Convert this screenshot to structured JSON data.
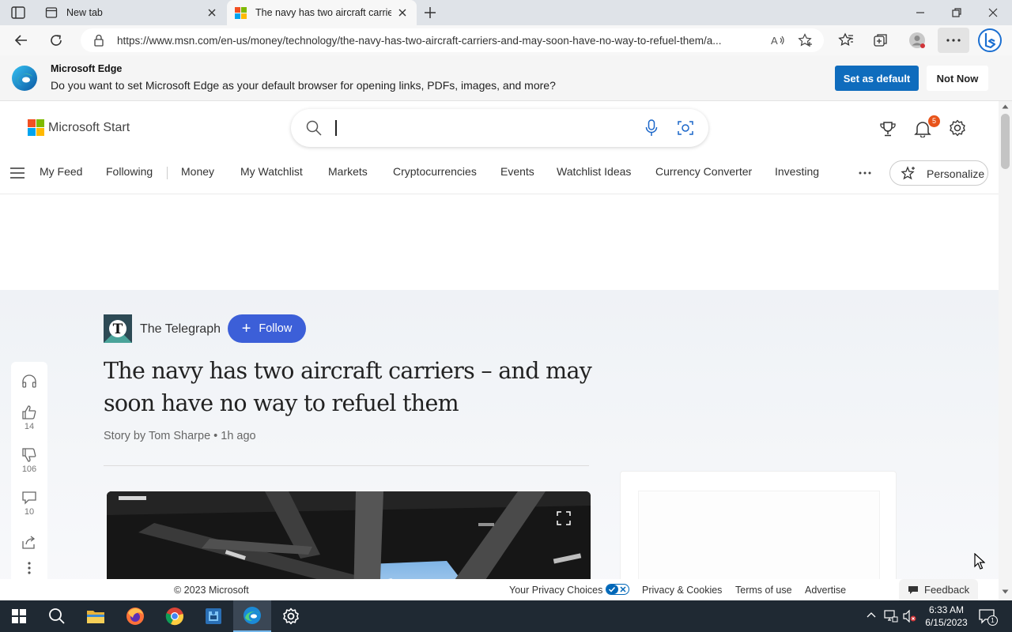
{
  "browser": {
    "tabs": [
      {
        "label": "New tab",
        "active": false
      },
      {
        "label": "The navy has two aircraft carriers – and may soon have no way to refuel them",
        "active": true
      }
    ],
    "url": "https://www.msn.com/en-us/money/technology/the-navy-has-two-aircraft-carriers-and-may-soon-have-no-way-to-refuel-them/a..."
  },
  "infobar": {
    "title": "Microsoft Edge",
    "message": "Do you want to set Microsoft Edge as your default browser for opening links, PDFs, images, and more?",
    "primary_button": "Set as default",
    "secondary_button": "Not Now"
  },
  "site": {
    "brand": "Microsoft Start",
    "notification_count": "5",
    "nav": [
      "My Feed",
      "Following",
      "Money",
      "My Watchlist",
      "Markets",
      "Cryptocurrencies",
      "Events",
      "Watchlist Ideas",
      "Currency Converter",
      "Investing"
    ],
    "personalize": "Personalize"
  },
  "article": {
    "publisher": "The Telegraph",
    "follow_label": "Follow",
    "headline": "The navy has two aircraft carriers – and may soon have no way to refuel them",
    "byline": "Story by Tom Sharpe • 1h ago",
    "likes": "14",
    "dislikes": "106",
    "comments": "10"
  },
  "footer": {
    "copyright": "© 2023 Microsoft",
    "privacy_choices": "Your Privacy Choices",
    "privacy_cookies": "Privacy & Cookies",
    "terms": "Terms of use",
    "advertise": "Advertise",
    "feedback": "Feedback"
  },
  "taskbar": {
    "time": "6:33 AM",
    "date": "6/15/2023",
    "notification_badge": "1"
  },
  "colors": {
    "edge_blue": "#0f6cbd",
    "follow_blue": "#3c5fd8",
    "notification_badge": "#e8541a",
    "taskbar": "#1f2933"
  }
}
